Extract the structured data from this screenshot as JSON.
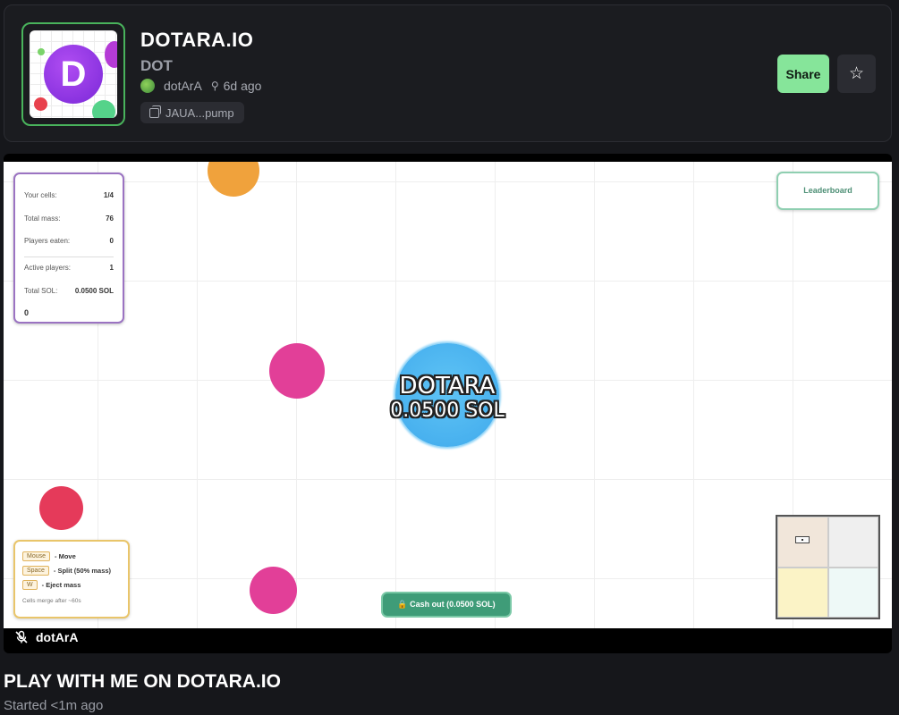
{
  "token": {
    "name": "DOTARA.IO",
    "ticker": "DOT",
    "logo_letter": "D",
    "creator": "dotArA",
    "age": "6d ago",
    "contract_short": "JAUA...pump"
  },
  "actions": {
    "share_label": "Share",
    "favorite_icon": "star-icon"
  },
  "game": {
    "stats": {
      "cells_label": "Your cells:",
      "cells_value": "1/4",
      "mass_label": "Total mass:",
      "mass_value": "76",
      "eaten_label": "Players eaten:",
      "eaten_value": "0",
      "active_label": "Active players:",
      "active_value": "1",
      "sol_label": "Total SOL:",
      "sol_value": "0.0500 SOL",
      "bottom_value": "0"
    },
    "leaderboard_label": "Leaderboard",
    "player": {
      "name": "DOTARA",
      "sol": "0.0500 SOL",
      "color": "#4bb5ef"
    },
    "controls": [
      {
        "key": "Mouse",
        "desc": "- Move"
      },
      {
        "key": "Space",
        "desc": "- Split (50% mass)"
      },
      {
        "key": "W",
        "desc": "- Eject mass"
      }
    ],
    "controls_note": "Cells merge after ~60s",
    "cash_out_label": "Cash out (0.0500 SOL)"
  },
  "stream": {
    "streamer": "dotArA",
    "mic_icon": "mic-off-icon",
    "title": "PLAY WITH ME ON DOTARA.IO",
    "started": "Started <1m ago"
  },
  "colors": {
    "accent_green": "#86e59a",
    "background": "#16171b",
    "card": "#1b1c20"
  }
}
